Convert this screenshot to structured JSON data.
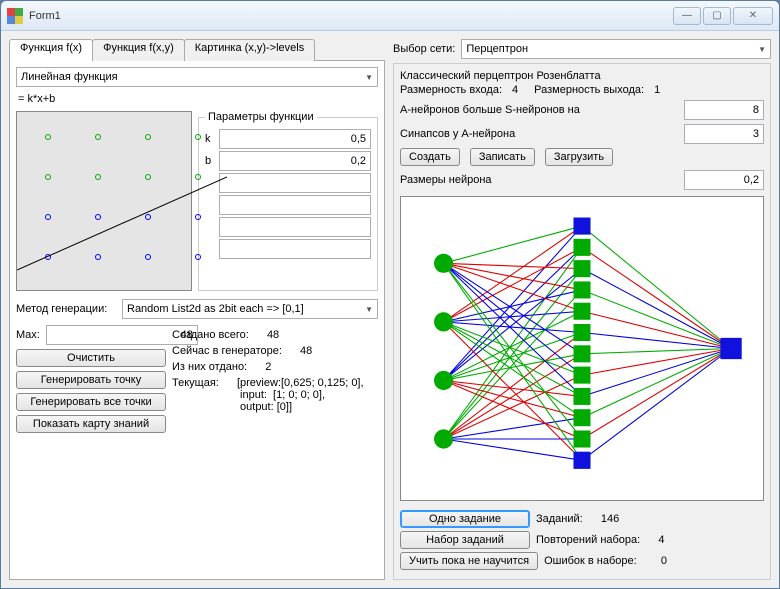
{
  "window": {
    "title": "Form1"
  },
  "tabs": {
    "t1": "Функция f(x)",
    "t2": "Функция f(x,y)",
    "t3": "Картинка (x,y)->levels"
  },
  "func": {
    "selector": "Линейная функция",
    "formula": "= k*x+b",
    "params_title": "Параметры функции",
    "k_label": "k",
    "k_val": "0,5",
    "b_label": "b",
    "b_val": "0,2"
  },
  "gen": {
    "method_label": "Метод генерации:",
    "method_val": "Random List2d as 2bit each => [0,1]",
    "max_label": "Max:",
    "max_val": "48",
    "created_label": "Создано всего:",
    "created_val": "48",
    "in_gen_label": "Сейчас в генераторе:",
    "in_gen_val": "48",
    "given_label": "Из них отдано:",
    "given_val": "2",
    "cur_label": "Текущая:",
    "cur_val": "[preview:[0,625; 0,125; 0],\n input:  [1; 0; 0; 0],\n output: [0]]",
    "btn_clear": "Очистить",
    "btn_gen_point": "Генерировать точку",
    "btn_gen_all": "Генерировать все точки",
    "btn_map": "Показать карту знаний"
  },
  "net": {
    "select_label": "Выбор сети:",
    "select_val": "Перцептрон",
    "header": "Классический перцептрон Розенблатта",
    "dim_in_label": "Размерность входа:",
    "dim_in_val": "4",
    "dim_out_label": "Размерность выхода:",
    "dim_out_val": "1",
    "a_more_s_label": "A-нейронов больше S-нейронов на",
    "a_more_s_val": "8",
    "syn_label": "Синапсов у A-нейрона",
    "syn_val": "3",
    "btn_create": "Создать",
    "btn_save": "Записать",
    "btn_load": "Загрузить",
    "size_label": "Размеры нейрона",
    "size_val": "0,2"
  },
  "train": {
    "btn_one": "Одно задание",
    "tasks_label": "Заданий:",
    "tasks_val": "146",
    "btn_batch": "Набор заданий",
    "rep_label": "Повторений набора:",
    "rep_val": "4",
    "btn_until": "Учить пока не научится",
    "err_label": "Ошибок в наборе:",
    "err_val": "0"
  },
  "chart_data": {
    "function_plot": {
      "type": "scatter+line",
      "points_above": [
        [
          0.15,
          0.15
        ],
        [
          0.4,
          0.15
        ],
        [
          0.65,
          0.15
        ],
        [
          0.9,
          0.15
        ],
        [
          0.15,
          0.38
        ],
        [
          0.4,
          0.38
        ],
        [
          0.65,
          0.38
        ],
        [
          0.9,
          0.38
        ]
      ],
      "points_below": [
        [
          0.15,
          0.62
        ],
        [
          0.4,
          0.62
        ],
        [
          0.65,
          0.62
        ],
        [
          0.9,
          0.62
        ],
        [
          0.15,
          0.85
        ],
        [
          0.4,
          0.85
        ],
        [
          0.65,
          0.85
        ],
        [
          0.9,
          0.85
        ]
      ],
      "line": {
        "slope": 0.5,
        "intercept": 0.2
      }
    },
    "network": {
      "type": "graph",
      "layers": [
        4,
        12,
        1
      ],
      "colors": [
        "green",
        "red",
        "blue"
      ]
    }
  }
}
